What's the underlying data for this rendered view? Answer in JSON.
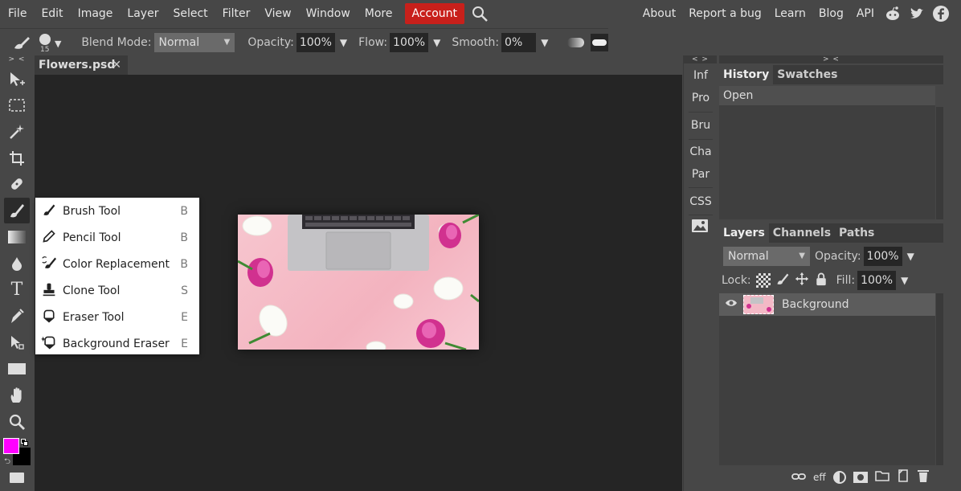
{
  "menubar": {
    "items": [
      "File",
      "Edit",
      "Image",
      "Layer",
      "Select",
      "Filter",
      "View",
      "Window",
      "More"
    ],
    "account": "Account",
    "right_links": [
      "About",
      "Report a bug",
      "Learn",
      "Blog",
      "API"
    ],
    "account_color": "#c8201b"
  },
  "options": {
    "brush_size": "15",
    "blend_label": "Blend Mode:",
    "blend_value": "Normal",
    "opacity_label": "Opacity:",
    "opacity_value": "100%",
    "flow_label": "Flow:",
    "flow_value": "100%",
    "smooth_label": "Smooth:",
    "smooth_value": "0%"
  },
  "document": {
    "tab_name": "Flowers.psd",
    "close": "✕"
  },
  "flyout": {
    "items": [
      {
        "label": "Brush Tool",
        "key": "B",
        "icon": "brush-icon"
      },
      {
        "label": "Pencil Tool",
        "key": "B",
        "icon": "pencil-icon"
      },
      {
        "label": "Color Replacement",
        "key": "B",
        "icon": "color-replacement-icon"
      },
      {
        "label": "Clone Tool",
        "key": "S",
        "icon": "clone-stamp-icon"
      },
      {
        "label": "Eraser Tool",
        "key": "E",
        "icon": "eraser-icon"
      },
      {
        "label": "Background Eraser",
        "key": "E",
        "icon": "background-eraser-icon"
      }
    ]
  },
  "mini_panel": {
    "items": [
      "Inf",
      "Pro",
      "Bru",
      "Cha",
      "Par",
      "CSS"
    ]
  },
  "history": {
    "tabs": [
      "History",
      "Swatches"
    ],
    "rows": [
      "Open"
    ]
  },
  "layers": {
    "tabs": [
      "Layers",
      "Channels",
      "Paths"
    ],
    "blend_value": "Normal",
    "opacity_label": "Opacity:",
    "opacity_value": "100%",
    "lock_label": "Lock:",
    "fill_label": "Fill:",
    "fill_value": "100%",
    "layer_name": "Background",
    "footer_eff": "eff"
  },
  "colors": {
    "foreground": "#ff00ff",
    "background": "#000000"
  }
}
